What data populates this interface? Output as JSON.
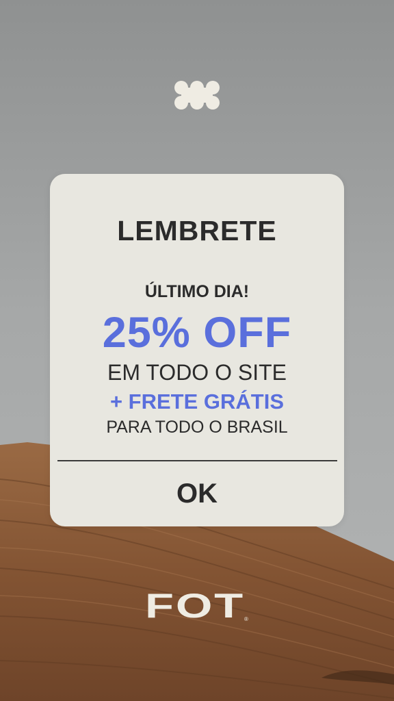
{
  "brand": {
    "top_icon": "brand-flower-icon",
    "logo_text": "FOT",
    "registered_mark": "®"
  },
  "popup": {
    "title": "LEMBRETE",
    "last_day": "ÚLTIMO DIA!",
    "discount": "25% OFF",
    "scope": "EM TODO O SITE",
    "shipping": "+ FRETE GRÁTIS",
    "shipping_scope": "PARA TODO O BRASIL",
    "ok_label": "OK"
  },
  "colors": {
    "accent": "#5a6fdc",
    "text": "#2b2b2b",
    "card": "#e8e7e0",
    "logo": "#efece3",
    "wood": "#8a5a36"
  }
}
